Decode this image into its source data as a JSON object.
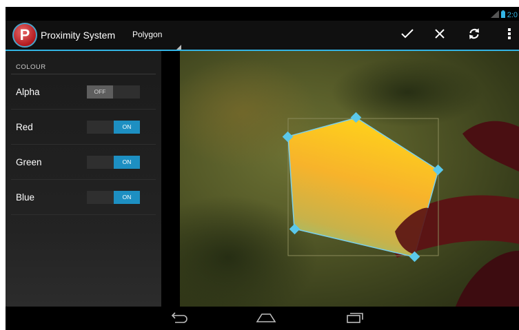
{
  "status_bar": {
    "clock": "2:0",
    "icons": [
      "signal-icon",
      "battery-icon"
    ]
  },
  "action_bar": {
    "app_title": "Proximity System",
    "app_icon_letter": "P",
    "mode_spinner": "Polygon",
    "actions": [
      "check-icon",
      "close-icon",
      "refresh-icon",
      "overflow-menu-icon"
    ]
  },
  "panel": {
    "section_header": "COLOUR",
    "rows": [
      {
        "label": "Alpha",
        "toggle": "OFF"
      },
      {
        "label": "Red",
        "toggle": "ON"
      },
      {
        "label": "Green",
        "toggle": "ON"
      },
      {
        "label": "Blue",
        "toggle": "ON"
      }
    ]
  },
  "navigation_bar": {
    "buttons": [
      "back-icon",
      "home-icon",
      "recent-apps-icon"
    ]
  },
  "colors": {
    "accent": "#33b5e5",
    "toggle_on": "#1d8fc2",
    "toggle_off": "#5e5e5e",
    "polygon_fill_top": "#ffd31a",
    "polygon_fill_bottom": "#8fc27a",
    "handle": "#5bc8ea"
  }
}
